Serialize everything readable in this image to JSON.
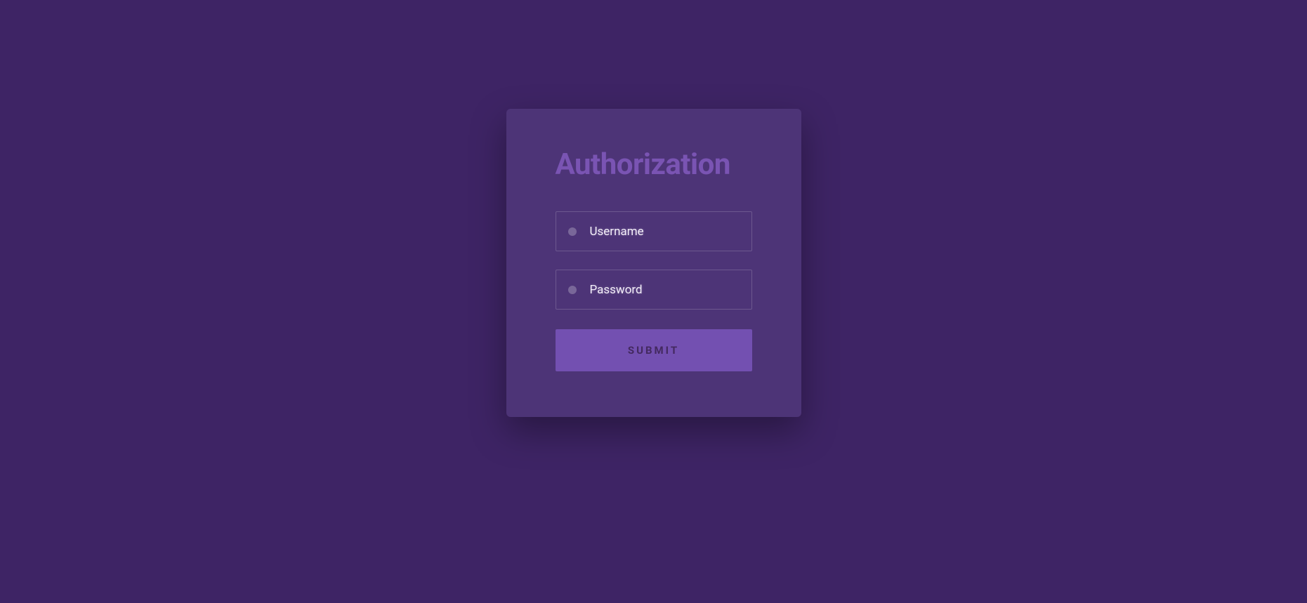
{
  "form": {
    "title": "Authorization",
    "username": {
      "placeholder": "Username",
      "value": ""
    },
    "password": {
      "placeholder": "Password",
      "value": ""
    },
    "submit_label": "SUBMIT"
  },
  "colors": {
    "page_bg": "#3e2465",
    "card_bg": "#4d3477",
    "title": "#7a54b3",
    "input_border": "rgba(255,255,255,0.18)",
    "button_bg": "#7350b1",
    "button_text": "#43295f"
  }
}
